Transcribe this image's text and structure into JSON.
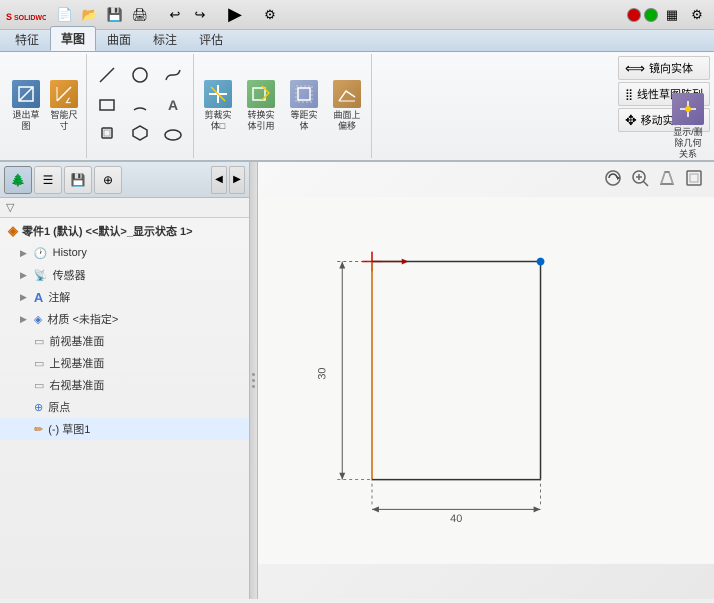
{
  "app": {
    "name": "SOLIDWORKS",
    "logo": "S"
  },
  "title_bar": {
    "icons": [
      "⬅",
      "➡",
      "↩",
      "▲",
      "💾",
      "🖨",
      "↺",
      "↪",
      "⬛"
    ]
  },
  "ribbon_tabs": [
    {
      "label": "特征",
      "active": false
    },
    {
      "label": "草图",
      "active": true
    },
    {
      "label": "曲面",
      "active": false
    },
    {
      "label": "标注",
      "active": false
    },
    {
      "label": "评估",
      "active": false
    }
  ],
  "ribbon": {
    "sections": [
      {
        "id": "exit-smart",
        "buttons_large": [
          {
            "label": "退出草\n图",
            "icon": "⬜"
          },
          {
            "label": "智能尺\n寸",
            "icon": "📐"
          }
        ]
      }
    ],
    "right_buttons": [
      {
        "label": "镜向实体",
        "icon": "⟺"
      },
      {
        "label": "线性草图阵列",
        "icon": "⣿"
      },
      {
        "label": "移动实体",
        "icon": "✥"
      }
    ],
    "far_right_button": {
      "label": "显示/删\n除几何\n关系",
      "icon": "🔗"
    }
  },
  "panel_toolbar": {
    "buttons": [
      {
        "label": "featuretree",
        "icon": "🌲",
        "active": true
      },
      {
        "label": "properties",
        "icon": "☰"
      },
      {
        "label": "save",
        "icon": "💾"
      },
      {
        "label": "target",
        "icon": "⊕"
      }
    ]
  },
  "tree": {
    "header": "零件1 (默认) <<默认>_显示状态 1>",
    "items": [
      {
        "label": "History",
        "icon": "🕐",
        "type": "history"
      },
      {
        "label": "传感器",
        "icon": "📡",
        "type": "sensor"
      },
      {
        "label": "注解",
        "icon": "A",
        "type": "annotation"
      },
      {
        "label": "材质 <未指定>",
        "icon": "◈",
        "type": "material"
      },
      {
        "label": "前视基准面",
        "icon": "▭",
        "type": "plane"
      },
      {
        "label": "上视基准面",
        "icon": "▭",
        "type": "plane"
      },
      {
        "label": "右视基准面",
        "icon": "▭",
        "type": "plane"
      },
      {
        "label": "原点",
        "icon": "⊕",
        "type": "origin"
      },
      {
        "label": "(-) 草图1",
        "icon": "✏",
        "type": "sketch"
      }
    ]
  },
  "drawing": {
    "dim_vertical": "30",
    "dim_horizontal": "40"
  },
  "colors": {
    "accent_blue": "#0066cc",
    "accent_red": "#cc0000",
    "line_dark": "#333333",
    "line_orange": "#cc6600",
    "bg_canvas": "#f5f5f0",
    "dim_line": "#555555"
  }
}
